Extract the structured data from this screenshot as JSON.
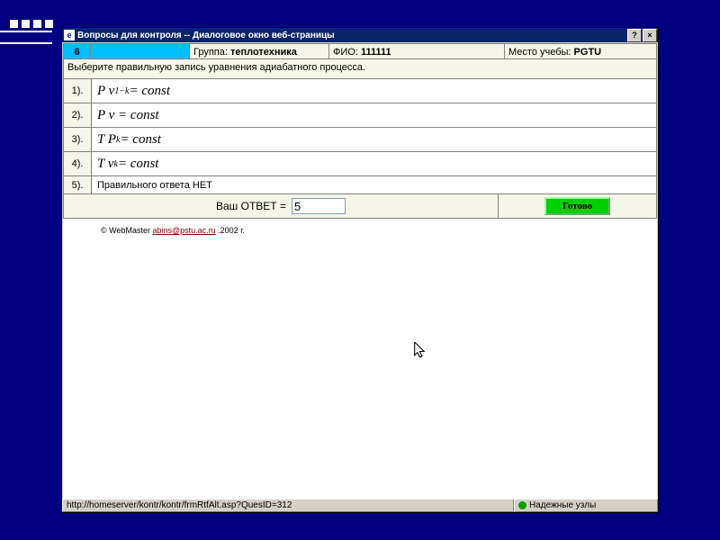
{
  "window": {
    "title": "Вопросы для контроля -- Диалоговое окно веб-страницы",
    "help_btn": "?",
    "close_btn": "×"
  },
  "header": {
    "question_number": "6",
    "group_label": "Группа:",
    "group_value": "теплотехника",
    "fio_label": "ФИО:",
    "fio_value": "111111",
    "place_label": "Место учебы:",
    "place_value": "PGTU"
  },
  "question_text": "Выберите правильную запись уравнения адиабатного процесса.",
  "answers": [
    {
      "num": "1).",
      "html": "P v<span class='sup'>1−k</span> = const"
    },
    {
      "num": "2).",
      "html": "P v = const"
    },
    {
      "num": "3).",
      "html": "T P<span class='sup'>k</span> = const"
    },
    {
      "num": "4).",
      "html": "T v<span class='sup'>k</span> = const"
    },
    {
      "num": "5).",
      "html": "Правильного ответа НЕТ",
      "plain": true
    }
  ],
  "footer": {
    "answer_label": "Ваш ОТВЕТ =",
    "answer_value": "5",
    "ready_label": "Готово"
  },
  "credit": {
    "prefix": "© WebMaster ",
    "email": "abins@pstu.ac.ru",
    "suffix": " .2002 г."
  },
  "statusbar": {
    "url": "http://homeserver/kontr/kontr/frmRtfAlt.asp?QuesID=312",
    "trust": "Надежные узлы"
  }
}
